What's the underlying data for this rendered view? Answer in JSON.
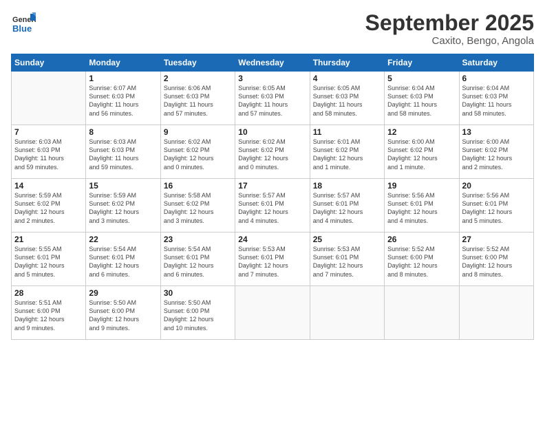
{
  "header": {
    "logo_line1": "General",
    "logo_line2": "Blue",
    "title": "September 2025",
    "subtitle": "Caxito, Bengo, Angola"
  },
  "days_of_week": [
    "Sunday",
    "Monday",
    "Tuesday",
    "Wednesday",
    "Thursday",
    "Friday",
    "Saturday"
  ],
  "weeks": [
    [
      {
        "day": "",
        "info": ""
      },
      {
        "day": "1",
        "info": "Sunrise: 6:07 AM\nSunset: 6:03 PM\nDaylight: 11 hours\nand 56 minutes."
      },
      {
        "day": "2",
        "info": "Sunrise: 6:06 AM\nSunset: 6:03 PM\nDaylight: 11 hours\nand 57 minutes."
      },
      {
        "day": "3",
        "info": "Sunrise: 6:05 AM\nSunset: 6:03 PM\nDaylight: 11 hours\nand 57 minutes."
      },
      {
        "day": "4",
        "info": "Sunrise: 6:05 AM\nSunset: 6:03 PM\nDaylight: 11 hours\nand 58 minutes."
      },
      {
        "day": "5",
        "info": "Sunrise: 6:04 AM\nSunset: 6:03 PM\nDaylight: 11 hours\nand 58 minutes."
      },
      {
        "day": "6",
        "info": "Sunrise: 6:04 AM\nSunset: 6:03 PM\nDaylight: 11 hours\nand 58 minutes."
      }
    ],
    [
      {
        "day": "7",
        "info": "Sunrise: 6:03 AM\nSunset: 6:03 PM\nDaylight: 11 hours\nand 59 minutes."
      },
      {
        "day": "8",
        "info": "Sunrise: 6:03 AM\nSunset: 6:03 PM\nDaylight: 11 hours\nand 59 minutes."
      },
      {
        "day": "9",
        "info": "Sunrise: 6:02 AM\nSunset: 6:02 PM\nDaylight: 12 hours\nand 0 minutes."
      },
      {
        "day": "10",
        "info": "Sunrise: 6:02 AM\nSunset: 6:02 PM\nDaylight: 12 hours\nand 0 minutes."
      },
      {
        "day": "11",
        "info": "Sunrise: 6:01 AM\nSunset: 6:02 PM\nDaylight: 12 hours\nand 1 minute."
      },
      {
        "day": "12",
        "info": "Sunrise: 6:00 AM\nSunset: 6:02 PM\nDaylight: 12 hours\nand 1 minute."
      },
      {
        "day": "13",
        "info": "Sunrise: 6:00 AM\nSunset: 6:02 PM\nDaylight: 12 hours\nand 2 minutes."
      }
    ],
    [
      {
        "day": "14",
        "info": "Sunrise: 5:59 AM\nSunset: 6:02 PM\nDaylight: 12 hours\nand 2 minutes."
      },
      {
        "day": "15",
        "info": "Sunrise: 5:59 AM\nSunset: 6:02 PM\nDaylight: 12 hours\nand 3 minutes."
      },
      {
        "day": "16",
        "info": "Sunrise: 5:58 AM\nSunset: 6:02 PM\nDaylight: 12 hours\nand 3 minutes."
      },
      {
        "day": "17",
        "info": "Sunrise: 5:57 AM\nSunset: 6:01 PM\nDaylight: 12 hours\nand 4 minutes."
      },
      {
        "day": "18",
        "info": "Sunrise: 5:57 AM\nSunset: 6:01 PM\nDaylight: 12 hours\nand 4 minutes."
      },
      {
        "day": "19",
        "info": "Sunrise: 5:56 AM\nSunset: 6:01 PM\nDaylight: 12 hours\nand 4 minutes."
      },
      {
        "day": "20",
        "info": "Sunrise: 5:56 AM\nSunset: 6:01 PM\nDaylight: 12 hours\nand 5 minutes."
      }
    ],
    [
      {
        "day": "21",
        "info": "Sunrise: 5:55 AM\nSunset: 6:01 PM\nDaylight: 12 hours\nand 5 minutes."
      },
      {
        "day": "22",
        "info": "Sunrise: 5:54 AM\nSunset: 6:01 PM\nDaylight: 12 hours\nand 6 minutes."
      },
      {
        "day": "23",
        "info": "Sunrise: 5:54 AM\nSunset: 6:01 PM\nDaylight: 12 hours\nand 6 minutes."
      },
      {
        "day": "24",
        "info": "Sunrise: 5:53 AM\nSunset: 6:01 PM\nDaylight: 12 hours\nand 7 minutes."
      },
      {
        "day": "25",
        "info": "Sunrise: 5:53 AM\nSunset: 6:01 PM\nDaylight: 12 hours\nand 7 minutes."
      },
      {
        "day": "26",
        "info": "Sunrise: 5:52 AM\nSunset: 6:00 PM\nDaylight: 12 hours\nand 8 minutes."
      },
      {
        "day": "27",
        "info": "Sunrise: 5:52 AM\nSunset: 6:00 PM\nDaylight: 12 hours\nand 8 minutes."
      }
    ],
    [
      {
        "day": "28",
        "info": "Sunrise: 5:51 AM\nSunset: 6:00 PM\nDaylight: 12 hours\nand 9 minutes."
      },
      {
        "day": "29",
        "info": "Sunrise: 5:50 AM\nSunset: 6:00 PM\nDaylight: 12 hours\nand 9 minutes."
      },
      {
        "day": "30",
        "info": "Sunrise: 5:50 AM\nSunset: 6:00 PM\nDaylight: 12 hours\nand 10 minutes."
      },
      {
        "day": "",
        "info": ""
      },
      {
        "day": "",
        "info": ""
      },
      {
        "day": "",
        "info": ""
      },
      {
        "day": "",
        "info": ""
      }
    ]
  ]
}
